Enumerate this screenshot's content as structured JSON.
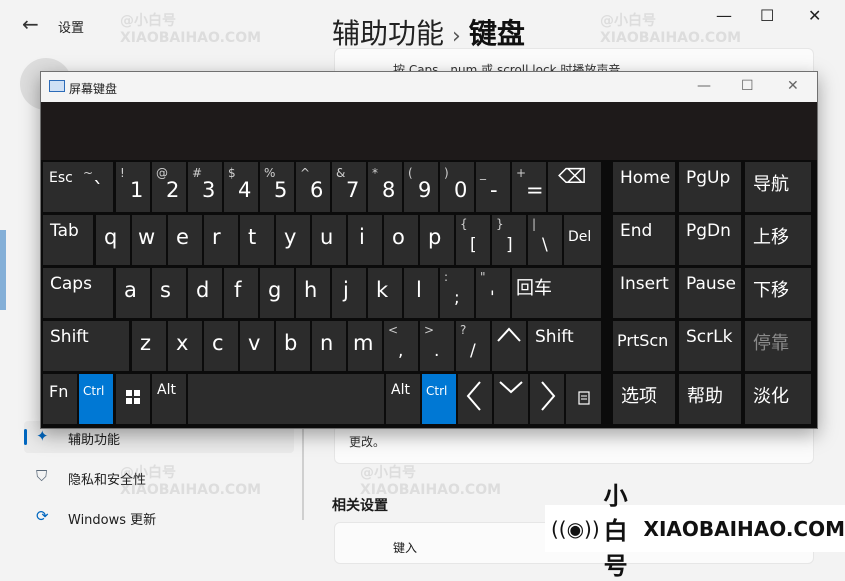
{
  "settings": {
    "back_icon": "←",
    "title": "设置",
    "heading": "辅助功能",
    "heading_sep": "›",
    "heading_current": "键盘",
    "top_card_text": "按 Caps、num 或 scroll lock 时播放声音",
    "bottom_card_text": "更改。",
    "related_title": "相关设置",
    "related_card_text": "键入",
    "nav": [
      {
        "label": "辅助功能",
        "icon": "accessibility-icon"
      },
      {
        "label": "隐私和安全性",
        "icon": "shield-icon"
      },
      {
        "label": "Windows 更新",
        "icon": "sync-icon"
      }
    ],
    "window_controls": {
      "minimize": "—",
      "maximize": "☐",
      "close": "✕"
    }
  },
  "watermark": {
    "cn": "@小白号",
    "en": "XIAOBAIHAO.COM",
    "brand_cn": "小白号",
    "brand_en": "XIAOBAIHAO.COM",
    "brand_icon": "((◉))"
  },
  "osk": {
    "title": "屏幕键盘",
    "controls": {
      "minimize": "—",
      "maximize": "☐",
      "close": "✕"
    },
    "keys": {
      "esc": "Esc",
      "n1": {
        "main": "1",
        "shift": "!"
      },
      "n2": {
        "main": "2",
        "shift": "@"
      },
      "n3": {
        "main": "3",
        "shift": "#"
      },
      "n4": {
        "main": "4",
        "shift": "$"
      },
      "n5": {
        "main": "5",
        "shift": "%"
      },
      "n6": {
        "main": "6",
        "shift": "^"
      },
      "n7": {
        "main": "7",
        "shift": "&"
      },
      "n8": {
        "main": "8",
        "shift": "*"
      },
      "n9": {
        "main": "9",
        "shift": "("
      },
      "n0": {
        "main": "0",
        "shift": ")"
      },
      "minus": {
        "main": "-",
        "shift": "_"
      },
      "equals": {
        "main": "=",
        "shift": "+"
      },
      "tilde": {
        "main": "`",
        "shift": "~"
      },
      "backspace": "⌫",
      "tab": "Tab",
      "q": "q",
      "w": "w",
      "e": "e",
      "r": "r",
      "t": "t",
      "y": "y",
      "u": "u",
      "i": "i",
      "o": "o",
      "p": "p",
      "lbracket": {
        "main": "[",
        "shift": "{"
      },
      "rbracket": {
        "main": "]",
        "shift": "}"
      },
      "backslash": {
        "main": "\\",
        "shift": "|"
      },
      "del": "Del",
      "caps": "Caps",
      "a": "a",
      "s": "s",
      "d": "d",
      "f": "f",
      "g": "g",
      "h": "h",
      "j": "j",
      "k": "k",
      "l": "l",
      "semicolon": {
        "main": ";",
        "shift": ":"
      },
      "quote": {
        "main": "'",
        "shift": "\""
      },
      "enter": "回车",
      "shift": "Shift",
      "z": "z",
      "x": "x",
      "c": "c",
      "v": "v",
      "b": "b",
      "n": "n",
      "m": "m",
      "comma": {
        "main": ",",
        "shift": "<"
      },
      "period": {
        "main": ".",
        "shift": ">"
      },
      "slash": {
        "main": "/",
        "shift": "?"
      },
      "fn": "Fn",
      "ctrl": "Ctrl",
      "alt": "Alt",
      "home": "Home",
      "pgup": "PgUp",
      "nav": "导航",
      "end": "End",
      "pgdn": "PgDn",
      "moveup": "上移",
      "insert": "Insert",
      "pause": "Pause",
      "movedown": "下移",
      "prtscn": "PrtScn",
      "scrlk": "ScrLk",
      "dock": "停靠",
      "options": "选项",
      "help": "帮助",
      "fade": "淡化"
    }
  }
}
